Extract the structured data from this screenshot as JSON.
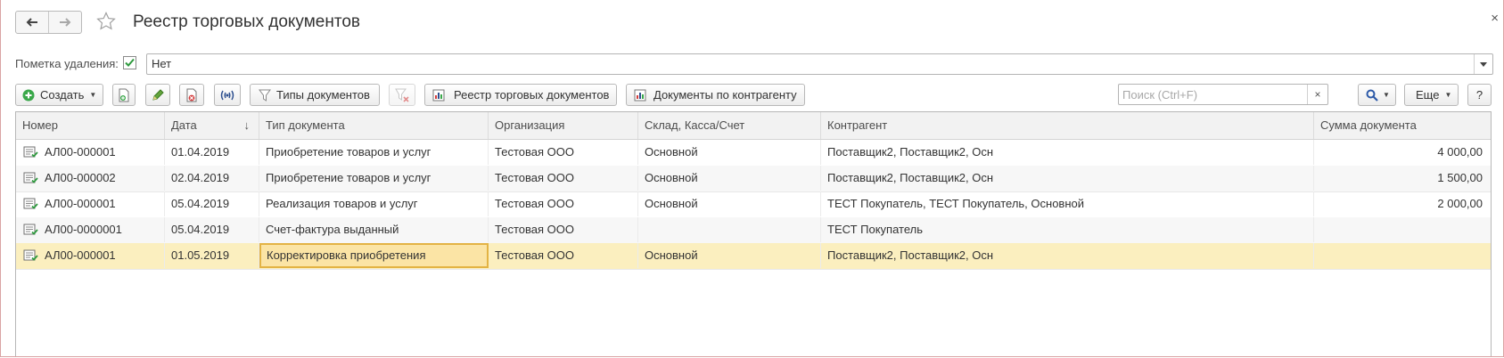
{
  "window": {
    "title": "Реестр торговых документов",
    "close_symbol": "×"
  },
  "filter": {
    "label": "Пометка удаления:",
    "checked": true,
    "value": "Нет"
  },
  "toolbar": {
    "create_label": "Создать",
    "doc_types_label": "Типы документов",
    "registry_report_label": "Реестр торговых документов",
    "by_counterparty_label": "Документы по контрагенту",
    "search_placeholder": "Поиск (Ctrl+F)",
    "search_clear": "×",
    "more_label": "Еще",
    "help_label": "?"
  },
  "table": {
    "columns": [
      "Номер",
      "Дата",
      "Тип документа",
      "Организация",
      "Склад, Касса/Счет",
      "Контрагент",
      "Сумма документа"
    ],
    "sort_indicator": "↓",
    "rows": [
      {
        "number": "АЛ00-000001",
        "date": "01.04.2019",
        "type": "Приобретение товаров и услуг",
        "org": "Тестовая ООО",
        "warehouse": "Основной",
        "counterparty": "Поставщик2, Поставщик2, Осн",
        "amount": "4 000,00"
      },
      {
        "number": "АЛ00-000002",
        "date": "02.04.2019",
        "type": "Приобретение товаров и услуг",
        "org": "Тестовая ООО",
        "warehouse": "Основной",
        "counterparty": "Поставщик2, Поставщик2, Осн",
        "amount": "1 500,00"
      },
      {
        "number": "АЛ00-000001",
        "date": "05.04.2019",
        "type": "Реализация товаров и услуг",
        "org": "Тестовая ООО",
        "warehouse": "Основной",
        "counterparty": "ТЕСТ Покупатель, ТЕСТ Покупатель, Основной",
        "amount": "2 000,00"
      },
      {
        "number": "АЛ00-0000001",
        "date": "05.04.2019",
        "type": "Счет-фактура выданный",
        "org": "Тестовая ООО",
        "warehouse": "",
        "counterparty": "ТЕСТ Покупатель",
        "amount": ""
      },
      {
        "number": "АЛ00-000001",
        "date": "01.05.2019",
        "type": "Корректировка приобретения",
        "org": "Тестовая ООО",
        "warehouse": "Основной",
        "counterparty": "Поставщик2, Поставщик2, Осн",
        "amount": ""
      }
    ],
    "selected_row": 4
  },
  "colors": {
    "accent_green": "#2e9a3e",
    "selection": "#fbefbf",
    "focus_cell": "#fbe4a5"
  }
}
